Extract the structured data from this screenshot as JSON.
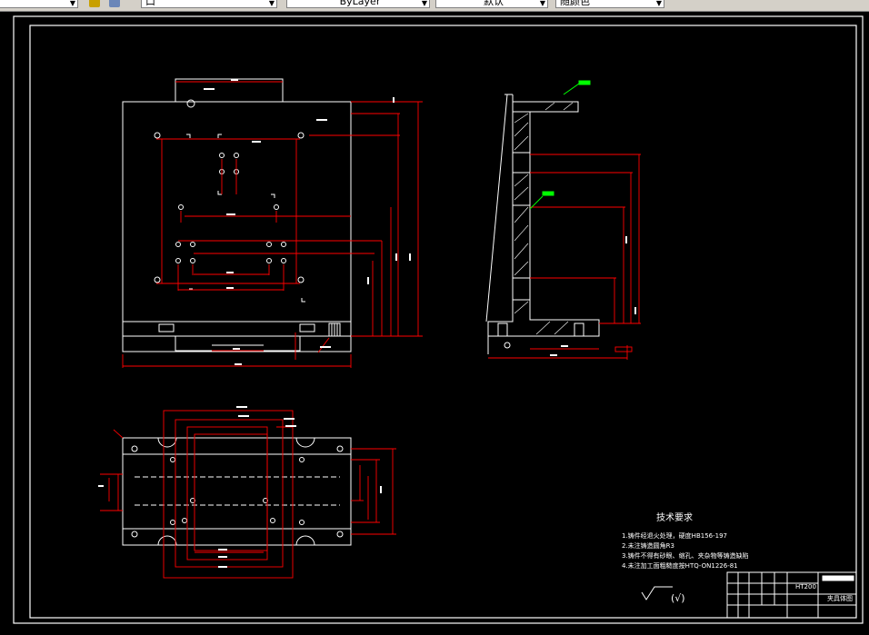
{
  "toolbar": {
    "layer_value": "口",
    "linetype_value": "ByLayer",
    "lineweight_value": "默认",
    "color_value": "随颜色"
  },
  "tech": {
    "title": "技术要求",
    "lines": [
      "1.铸件经退火处理，硬度HB156-197",
      "2.未注铸造圆角R3",
      "3.铸件不得有砂眼、缩孔、夹杂物等铸造缺陷",
      "4.未注加工面粗糙度按HTQ-ON1226-81"
    ],
    "roughness": "(√)"
  },
  "title_block": {
    "part_name": "夹具体图",
    "material": "HT200"
  },
  "colors": {
    "drawing_line": "#ffffff",
    "dimension": "#ff0000",
    "leader": "#00ff00",
    "background": "#000000",
    "toolbar": "#d4d0c8"
  }
}
